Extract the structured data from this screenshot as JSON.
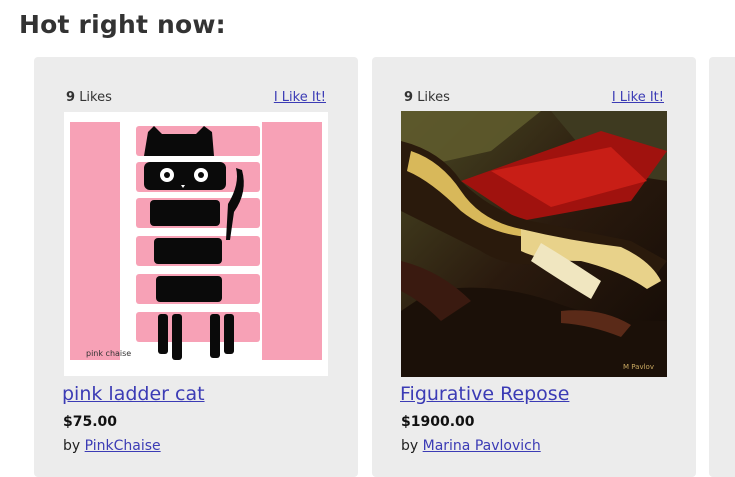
{
  "section": {
    "heading": "Hot right now:"
  },
  "products": [
    {
      "likes_count": "9",
      "likes_label": "Likes",
      "like_button": "I Like It!",
      "artwork_signature": "pink chaise",
      "title": "pink ladder cat",
      "price": "$75.00",
      "by_prefix": "by",
      "artist": "PinkChaise",
      "colors": {
        "pink": "#f7a1b6",
        "cat": "#0a0a0a"
      }
    },
    {
      "likes_count": "9",
      "likes_label": "Likes",
      "like_button": "I Like It!",
      "artwork_signature": "M Pavlov",
      "title": "Figurative Repose",
      "price": "$1900.00",
      "by_prefix": "by",
      "artist": "Marina Pavlovich",
      "colors": {
        "red": "#b01a14",
        "gold": "#d8b85a",
        "olive": "#5e5a2c"
      }
    }
  ],
  "colors": {
    "link": "#3b3bb5",
    "card_bg": "#ececec",
    "heading": "#333333"
  }
}
